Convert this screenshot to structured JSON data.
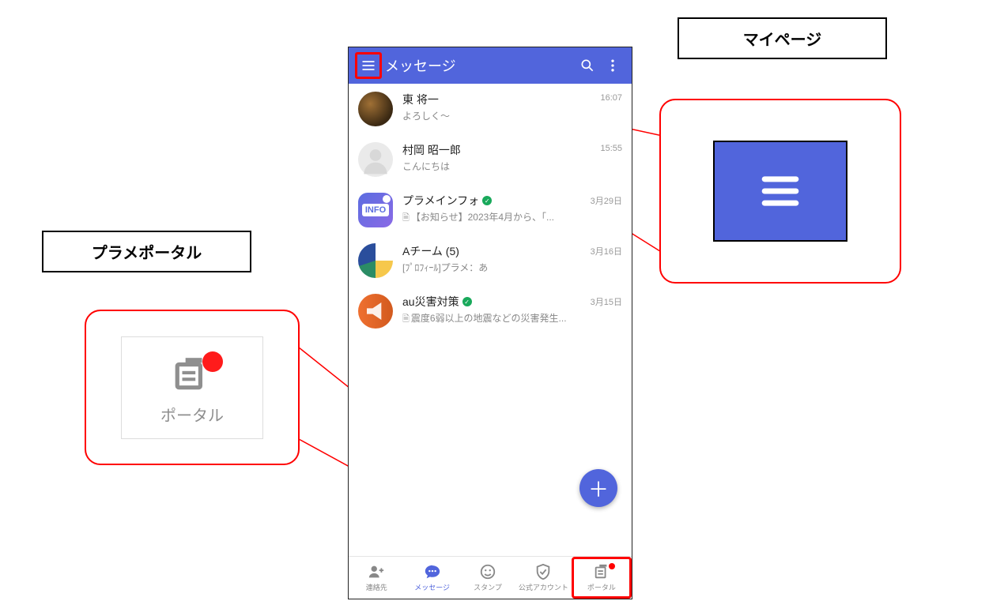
{
  "colors": {
    "primary": "#5165dc",
    "highlight": "#ff0000"
  },
  "appbar": {
    "title": "メッセージ"
  },
  "conversations": [
    {
      "name": "東 将一",
      "preview": "よろしく～",
      "time": "16:07"
    },
    {
      "name": "村岡 昭一郎",
      "preview": "こんにちは",
      "time": "15:55"
    },
    {
      "name": "プラメインフォ",
      "preview": "【お知らせ】2023年4月から、「...",
      "time": "3月29日",
      "verified": true,
      "doc": true,
      "info_badge": "INFO"
    },
    {
      "name": "Aチーム (5)",
      "preview": "[ﾌﾟﾛﾌｨｰﾙ]プラメ：あ",
      "time": "3月16日"
    },
    {
      "name": "au災害対策",
      "preview": "震度6弱以上の地震などの災害発生...",
      "time": "3月15日",
      "verified": true,
      "doc": true
    }
  ],
  "nav": {
    "contacts": "連絡先",
    "messages": "メッセージ",
    "stamps": "スタンプ",
    "official": "公式アカウント",
    "portal": "ポータル"
  },
  "callouts": {
    "mypage_label": "マイページ",
    "portal_label": "プラメポータル",
    "portal_icon_label": "ポータル"
  }
}
